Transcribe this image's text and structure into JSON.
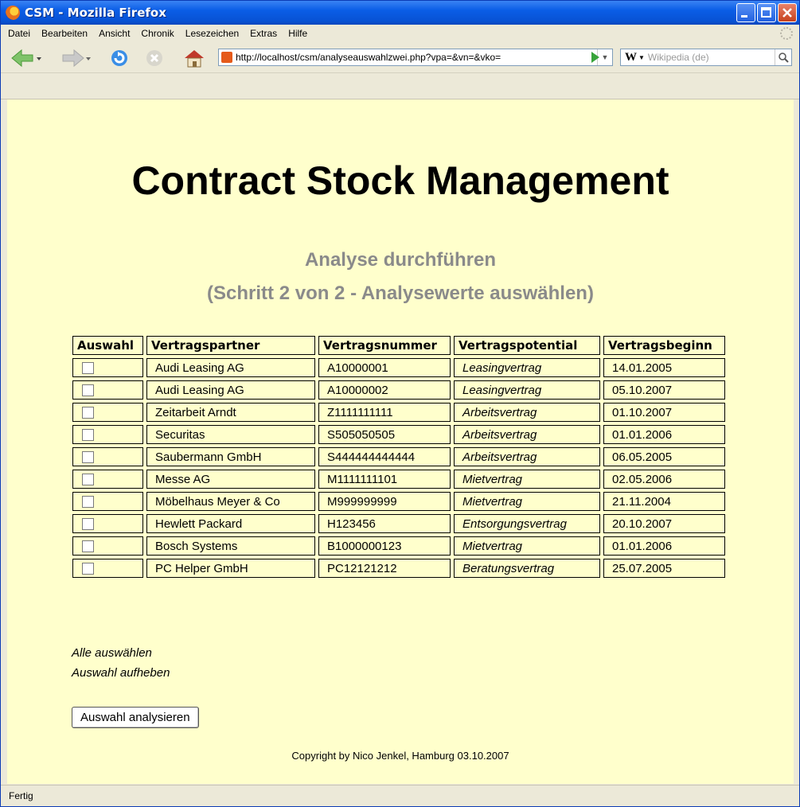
{
  "window": {
    "title": "CSM - Mozilla Firefox"
  },
  "menu": [
    "Datei",
    "Bearbeiten",
    "Ansicht",
    "Chronik",
    "Lesezeichen",
    "Extras",
    "Hilfe"
  ],
  "toolbar": {
    "url": "http://localhost/csm/analyseauswahlzwei.php?vpa=&vn=&vko=",
    "search_engine": "W",
    "search_placeholder": "Wikipedia (de)"
  },
  "page": {
    "heading": "Contract Stock Management",
    "subheading1": "Analyse durchführen",
    "subheading2": "(Schritt 2 von 2 - Analysewerte auswählen)",
    "columns": [
      "Auswahl",
      "Vertragspartner",
      "Vertragsnummer",
      "Vertragspotential",
      "Vertragsbeginn"
    ],
    "rows": [
      {
        "checked": false,
        "partner": "Audi Leasing AG",
        "nummer": "A10000001",
        "potential": "Leasingvertrag",
        "beginn": "14.01.2005"
      },
      {
        "checked": false,
        "partner": "Audi Leasing AG",
        "nummer": "A10000002",
        "potential": "Leasingvertrag",
        "beginn": "05.10.2007"
      },
      {
        "checked": false,
        "partner": "Zeitarbeit Arndt",
        "nummer": "Z1111111111",
        "potential": "Arbeitsvertrag",
        "beginn": "01.10.2007"
      },
      {
        "checked": false,
        "partner": "Securitas",
        "nummer": "S505050505",
        "potential": "Arbeitsvertrag",
        "beginn": "01.01.2006"
      },
      {
        "checked": false,
        "partner": "Saubermann GmbH",
        "nummer": "S444444444444",
        "potential": "Arbeitsvertrag",
        "beginn": "06.05.2005"
      },
      {
        "checked": false,
        "partner": "Messe AG",
        "nummer": "M1111111101",
        "potential": "Mietvertrag",
        "beginn": "02.05.2006"
      },
      {
        "checked": false,
        "partner": "Möbelhaus Meyer & Co",
        "nummer": "M999999999",
        "potential": "Mietvertrag",
        "beginn": "21.11.2004"
      },
      {
        "checked": false,
        "partner": "Hewlett Packard",
        "nummer": "H123456",
        "potential": "Entsorgungsvertrag",
        "beginn": "20.10.2007"
      },
      {
        "checked": false,
        "partner": "Bosch Systems",
        "nummer": "B1000000123",
        "potential": "Mietvertrag",
        "beginn": "01.01.2006"
      },
      {
        "checked": false,
        "partner": "PC Helper GmbH",
        "nummer": "PC12121212",
        "potential": "Beratungsvertrag",
        "beginn": "25.07.2005"
      }
    ],
    "select_all": "Alle auswählen",
    "deselect": "Auswahl aufheben",
    "submit": "Auswahl analysieren",
    "copyright": "Copyright by Nico Jenkel, Hamburg 03.10.2007"
  },
  "status": "Fertig",
  "colors": {
    "page_bg": "#FFFFCC",
    "titlebar": "#0A5DE6",
    "subheading": "#8A8A8A",
    "chrome": "#ECE9D8"
  }
}
